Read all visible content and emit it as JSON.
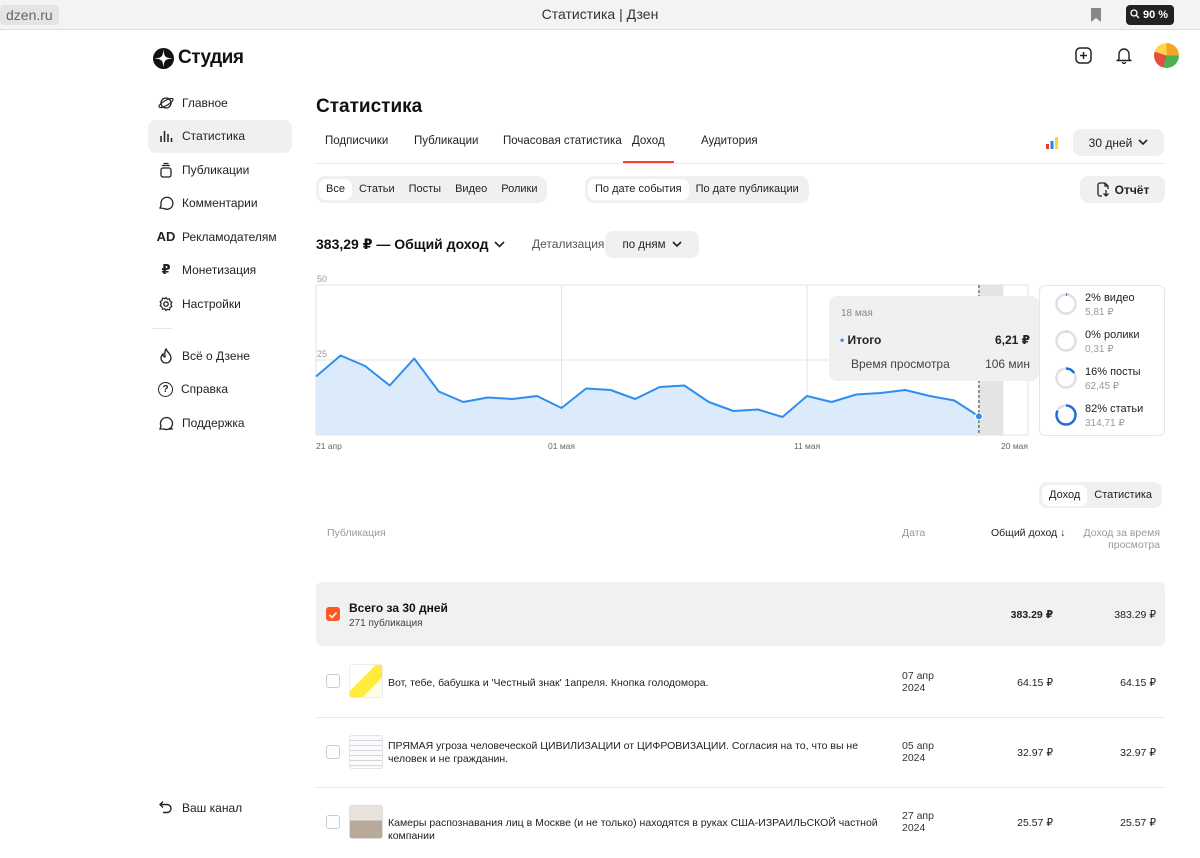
{
  "browser": {
    "url": "dzen.ru",
    "title": "Статистика | Дзен",
    "zoom": "90 %"
  },
  "app": {
    "logo_text": "Студия"
  },
  "sidebar": {
    "items": [
      {
        "label": "Главное",
        "icon": "planet-icon"
      },
      {
        "label": "Статистика",
        "icon": "bar-chart-icon"
      },
      {
        "label": "Публикации",
        "icon": "stack-icon"
      },
      {
        "label": "Комментарии",
        "icon": "comment-icon"
      },
      {
        "label": "Рекламодателям",
        "icon": "ad-icon",
        "glyph": "AD"
      },
      {
        "label": "Монетизация",
        "icon": "ruble-icon",
        "glyph": "₽"
      },
      {
        "label": "Настройки",
        "icon": "gear-icon"
      }
    ],
    "items2": [
      {
        "label": "Всё о Дзене",
        "icon": "flame-icon"
      },
      {
        "label": "Справка",
        "icon": "help-icon",
        "glyph": "?"
      },
      {
        "label": "Поддержка",
        "icon": "chat-icon"
      }
    ],
    "channel_label": "Ваш канал"
  },
  "page": {
    "title": "Статистика"
  },
  "tabs": [
    "Подписчики",
    "Публикации",
    "Почасовая статистика",
    "Доход",
    "Аудитория"
  ],
  "period_label": "30 дней",
  "filters": {
    "type": [
      "Все",
      "Статьи",
      "Посты",
      "Видео",
      "Ролики"
    ],
    "date_mode": [
      "По дате события",
      "По дате публикации"
    ]
  },
  "report_label": "Отчёт",
  "summary": {
    "total": "383,29 ₽ — Общий доход",
    "detail_label": "Детализация",
    "detail_value": "по дням"
  },
  "chart_data": {
    "type": "area",
    "y_ticks": [
      "50",
      "25",
      "0"
    ],
    "ylim": [
      0,
      50
    ],
    "x_tick_labels": [
      "21 апр",
      "01 мая",
      "11 мая",
      "20 мая"
    ],
    "x": [
      "21 апр",
      "22 апр",
      "23 апр",
      "24 апр",
      "25 апр",
      "26 апр",
      "27 апр",
      "28 апр",
      "29 апр",
      "30 апр",
      "01 мая",
      "02 мая",
      "03 мая",
      "04 мая",
      "05 мая",
      "06 мая",
      "07 мая",
      "08 мая",
      "09 мая",
      "10 мая",
      "11 мая",
      "12 мая",
      "13 мая",
      "14 мая",
      "15 мая",
      "16 мая",
      "17 мая",
      "18 мая"
    ],
    "values": [
      19.5,
      26.5,
      23,
      16.5,
      25.5,
      14.5,
      11,
      12.5,
      12,
      13,
      9,
      15.5,
      15,
      12,
      16,
      16.5,
      11,
      8,
      8.5,
      6,
      13,
      11,
      13.5,
      14,
      15,
      13,
      11.5,
      6.21
    ],
    "highlight_index": 27,
    "colors": {
      "line": "#2e8ef0",
      "fill": "#dcebfb",
      "highlight_band": "#e4e4e4"
    }
  },
  "tooltip": {
    "date": "18 мая",
    "total_label": "Итого",
    "total_value": "6,21 ₽",
    "watch_label": "Время просмотра",
    "watch_value": "106 мин"
  },
  "breakdown": [
    {
      "label": "2% видео",
      "value": "5,81 ₽",
      "percent": 2
    },
    {
      "label": "0% ролики",
      "value": "0,31 ₽",
      "percent": 0.5
    },
    {
      "label": "16% посты",
      "value": "62,45 ₽",
      "percent": 16
    },
    {
      "label": "82% статьи",
      "value": "314,71 ₽",
      "percent": 82
    }
  ],
  "table_toggle": [
    "Доход",
    "Статистика"
  ],
  "table": {
    "headers": {
      "publication": "Публикация",
      "date": "Дата",
      "total": "Общий доход ↓",
      "watch": "Доход за время просмотра"
    },
    "total_row": {
      "title": "Всего за 30 дней",
      "sub": "271 публикация",
      "total": "383.29 ₽",
      "watch": "383.29 ₽"
    },
    "rows": [
      {
        "title": "Вот, тебе, бабушка и 'Честный знак' 1апреля. Кнопка голодомора.",
        "date": "07 апр 2024",
        "total": "64.15 ₽",
        "watch": "64.15 ₽"
      },
      {
        "title": "ПРЯМАЯ угроза человеческой ЦИВИЛИЗАЦИИ от ЦИФРОВИЗАЦИИ. Согласия на то, что вы не человек и не гражданин.",
        "date": "05 апр 2024",
        "total": "32.97 ₽",
        "watch": "32.97 ₽"
      },
      {
        "title": "Камеры распознавания лиц в Москве (и не только) находятся в руках США-ИЗРАИЛЬСКОЙ частной компании",
        "date": "27 апр 2024",
        "total": "25.57 ₽",
        "watch": "25.57 ₽"
      }
    ]
  }
}
